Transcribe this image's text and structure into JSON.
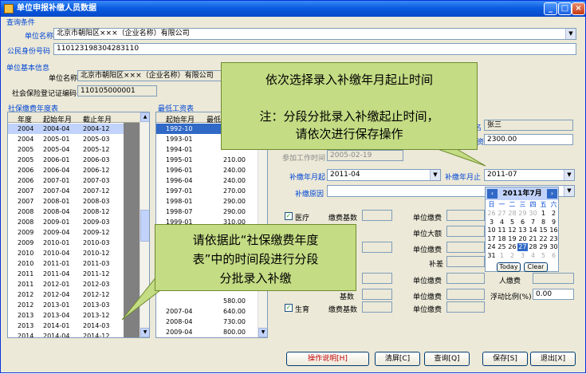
{
  "window": {
    "title": "单位申报补缴人员数据",
    "btn_min": "_",
    "btn_max": "□",
    "btn_close": "×"
  },
  "query": {
    "group": "查询条件",
    "unit_name_label": "单位名称",
    "unit_name_value": "北京市朝阳区×××（企业名称）有限公司",
    "id_label": "公民身份号码",
    "id_value": "110123198304283110"
  },
  "unit_info": {
    "group": "单位基本信息",
    "unit_name_label": "单位名称",
    "unit_name_value": "北京市朝阳区×××（企业名称）有限公司",
    "reg_label": "社会保险登记证编码",
    "reg_value": "110105000001"
  },
  "year_table": {
    "group": "社保缴费年度表",
    "headers": [
      "年度",
      "起始年月",
      "截止年月"
    ],
    "rows": [
      [
        "2004",
        "2004-04",
        "2004-12"
      ],
      [
        "2004",
        "2005-01",
        "2005-03"
      ],
      [
        "2005",
        "2005-04",
        "2005-12"
      ],
      [
        "2005",
        "2006-01",
        "2006-03"
      ],
      [
        "2006",
        "2006-04",
        "2006-12"
      ],
      [
        "2006",
        "2007-01",
        "2007-03"
      ],
      [
        "2007",
        "2007-04",
        "2007-12"
      ],
      [
        "2007",
        "2008-01",
        "2008-03"
      ],
      [
        "2008",
        "2008-04",
        "2008-12"
      ],
      [
        "2008",
        "2009-01",
        "2009-03"
      ],
      [
        "2009",
        "2009-04",
        "2009-12"
      ],
      [
        "2009",
        "2010-01",
        "2010-03"
      ],
      [
        "2010",
        "2010-04",
        "2010-12"
      ],
      [
        "2010",
        "2011-01",
        "2011-03"
      ],
      [
        "2011",
        "2011-04",
        "2011-12"
      ],
      [
        "2011",
        "2012-01",
        "2012-03"
      ],
      [
        "2012",
        "2012-04",
        "2012-12"
      ],
      [
        "2012",
        "2013-01",
        "2013-03"
      ],
      [
        "2013",
        "2013-04",
        "2013-12"
      ],
      [
        "2013",
        "2014-01",
        "2014-03"
      ],
      [
        "2014",
        "2014-04",
        "2014-12"
      ]
    ]
  },
  "wage_table": {
    "group": "最低工资表",
    "headers": [
      "起始年月",
      "最低"
    ],
    "rows": [
      [
        "1992-10",
        ""
      ],
      [
        "1993-01",
        ""
      ],
      [
        "1994-01",
        ""
      ],
      [
        "1995-01",
        "210.00"
      ],
      [
        "1996-01",
        "240.00"
      ],
      [
        "1996-04",
        "240.00"
      ],
      [
        "1997-01",
        "270.00"
      ],
      [
        "1998-01",
        "290.00"
      ],
      [
        "1998-07",
        "290.00"
      ],
      [
        "1999-01",
        "310.00"
      ]
    ],
    "bottom_rows": [
      [
        "",
        "580.00"
      ],
      [
        "2007-04",
        "640.00"
      ],
      [
        "2008-04",
        "730.00"
      ],
      [
        "2009-04",
        "800.00"
      ]
    ]
  },
  "form": {
    "name_label": "名",
    "name_value": "张三",
    "wage_label": "资",
    "wage_value": "2300.00",
    "work_date_label": "参加工作时间",
    "work_date_value": "2005-02-19",
    "start_label": "补缴年月起",
    "start_value": "2011-04",
    "end_label": "补缴年月止",
    "end_value": "2011-07",
    "reason_label": "补缴原因"
  },
  "insurance": {
    "medical": {
      "label": "医疗",
      "checked": true,
      "base_label": "缴费基数",
      "unit_pay_label": "单位缴费",
      "big_label": "单位大额",
      "pay2_label": "单位缴费",
      "diff_label": "补差"
    },
    "base2_label": "基数",
    "base3_label": "基数",
    "birth": {
      "label": "生育",
      "checked": true,
      "base_label": "缴费基数",
      "unit_pay_label": "单位缴费"
    },
    "unit_pay3_label": "单位缴费",
    "unit_pay4_label": "单位缴费",
    "person_label": "人缴费",
    "float_label": "浮动比例(%)",
    "float_value": "0.00"
  },
  "calendar": {
    "title": "2011年7月",
    "weekdays": [
      "日",
      "一",
      "二",
      "三",
      "四",
      "五",
      "六"
    ],
    "weeks": [
      [
        "26",
        "27",
        "28",
        "29",
        "30",
        "1",
        "2"
      ],
      [
        "3",
        "4",
        "5",
        "6",
        "7",
        "8",
        "9"
      ],
      [
        "10",
        "11",
        "12",
        "13",
        "14",
        "15",
        "16"
      ],
      [
        "17",
        "18",
        "19",
        "20",
        "21",
        "22",
        "23"
      ],
      [
        "24",
        "25",
        "26",
        "27",
        "28",
        "29",
        "30"
      ],
      [
        "31",
        "1",
        "2",
        "3",
        "4",
        "5",
        "6"
      ]
    ],
    "selected": "27",
    "today_label": "Today",
    "clear_label": "Clear"
  },
  "callouts": {
    "top_line1": "依次选择录入补缴年月起止时间",
    "top_line2": "注：分段分批录入补缴起止时间，",
    "top_line3": "请依次进行保存操作",
    "left_line1": "请依据此“社保缴费年度",
    "left_line2": "表”中的时间段进行分段",
    "left_line3": "分批录入补缴"
  },
  "buttons": {
    "help": "操作说明[H]",
    "clear": "清屏[C]",
    "query": "查询[Q]",
    "save": "保存[S]",
    "exit": "退出[X]"
  },
  "colors": {
    "callout_bg": "#c4dc84",
    "title_bar": "#0a5ce0",
    "selected_row": "#c1d3fb"
  }
}
